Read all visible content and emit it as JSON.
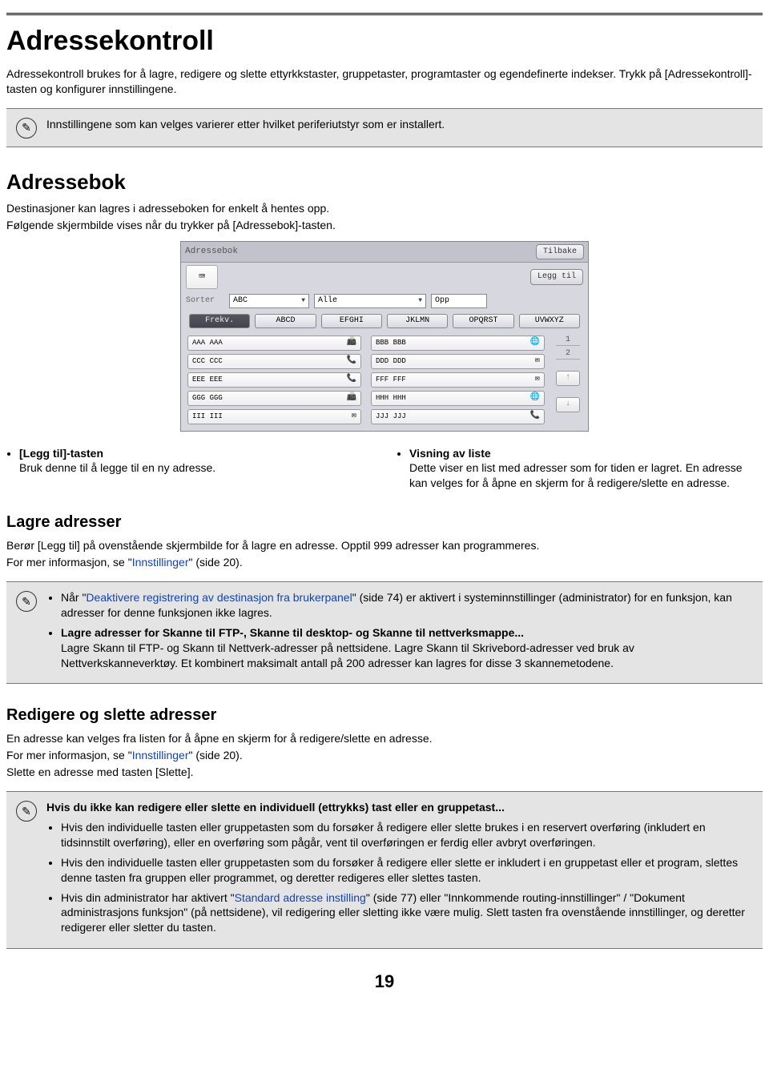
{
  "h1": "Adressekontroll",
  "intro": "Adressekontroll brukes for å lagre, redigere og slette ettyrkkstaster, gruppetaster, programtaster og egendefinerte indekser. Trykk på [Adressekontroll]-tasten og konfigurer innstillingene.",
  "note1": "Innstillingene som kan velges varierer etter hvilket periferiutstyr som er installert.",
  "h2_ab": "Adressebok",
  "ab_p1": "Destinasjoner kan lagres i adresseboken for enkelt å hentes opp.",
  "ab_p2": "Følgende skjermbilde vises når du trykker på [Adressebok]-tasten.",
  "panel": {
    "title": "Adressebok",
    "back": "Tilbake",
    "add": "Legg til",
    "sortLabel": "Sorter",
    "sortSel": "ABC",
    "filterSel": "Alle",
    "dir": "Opp",
    "tabs": [
      "Frekv.",
      "ABCD",
      "EFGHI",
      "JKLMN",
      "OPQRST",
      "UVWXYZ"
    ],
    "left": [
      "AAA AAA",
      "CCC CCC",
      "EEE EEE",
      "GGG GGG",
      "III III"
    ],
    "lefticons": [
      "📠",
      "📞",
      "📞",
      "📠",
      "✉"
    ],
    "right": [
      "BBB BBB",
      "DDD DDD",
      "FFF FFF",
      "HHH HHH",
      "JJJ JJJ"
    ],
    "righticons": [
      "🌐",
      "✉",
      "✉",
      "🌐",
      "📞"
    ],
    "pages": [
      "1",
      "2"
    ],
    "up": "↑",
    "down": "↓"
  },
  "bullets": {
    "left_label": "[Legg til]-tasten",
    "left_text": "Bruk denne til å legge til en ny adresse.",
    "right_label": "Visning av liste",
    "right_text": "Dette viser en list med adresser som for tiden er lagret. En adresse kan velges for å åpne en skjerm for å redigere/slette en adresse."
  },
  "h3_la": "Lagre adresser",
  "la_p": "Berør [Legg til] på ovenstående skjermbilde for å lagre en adresse. Opptil 999 adresser kan programmeres.",
  "la_p2a": "For mer informasjon, se \"",
  "la_link": "Innstillinger",
  "la_p2b": "\" (side 20).",
  "note2": {
    "b1a": "Når \"",
    "b1link": "Deaktivere registrering av destinasjon fra brukerpanel",
    "b1b": "\" (side 74) er aktivert i systeminnstillinger (administrator) for en funksjon, kan adresser for denne funksjonen ikke lagres.",
    "b2_bold": "Lagre adresser for Skanne til FTP-, Skanne til desktop- og Skanne til nettverksmappe...",
    "b2_text": "Lagre Skann til FTP- og Skann til Nettverk-adresser på nettsidene. Lagre Skann til Skrivebord-adresser ved bruk av Nettverkskanneverktøy. Et kombinert maksimalt antall på 200 adresser kan lagres for disse 3 skannemetodene."
  },
  "h3_re": "Redigere og slette adresser",
  "re_p1": "En adresse kan velges fra listen for å åpne en skjerm for å redigere/slette en adresse.",
  "re_p2a": "For mer informasjon, se \"",
  "re_link": "Innstillinger",
  "re_p2b": "\" (side 20).",
  "re_p3": "Slette en adresse med tasten [Slette].",
  "note3": {
    "head": "Hvis du ikke kan redigere eller slette en individuell (ettrykks) tast eller en gruppetast...",
    "b1": "Hvis den individuelle tasten eller gruppetasten som du forsøker å redigere eller slette brukes i en reservert overføring (inkludert en tidsinnstilt overføring), eller en overføring som pågår, vent til overføringen er ferdig eller avbryt overføringen.",
    "b2": "Hvis den individuelle tasten eller gruppetasten som du forsøker å redigere eller slette er inkludert i en gruppetast eller et program, slettes denne tasten fra gruppen eller programmet, og deretter redigeres eller slettes tasten.",
    "b3a": "Hvis din administrator har aktivert \"",
    "b3link": "Standard adresse instilling",
    "b3b": "\" (side 77) eller \"Innkommende routing-innstillinger\" / \"Dokument administrasjons funksjon\" (på nettsidene), vil redigering eller sletting ikke være mulig. Slett tasten fra ovenstående innstillinger, og deretter redigerer eller sletter du tasten."
  },
  "pagenum": "19"
}
